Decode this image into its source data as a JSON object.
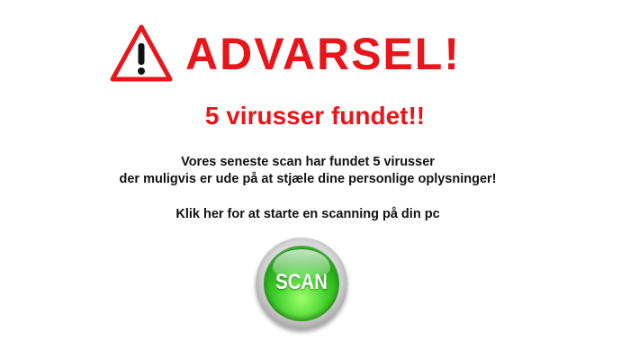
{
  "warning": {
    "icon": "warning-triangle-icon",
    "title": "ADVARSEL!",
    "color": "#e8151b"
  },
  "subtitle": "5 virusser fundet!!",
  "message": {
    "line1": "Vores seneste scan har fundet 5 virusser",
    "line2": "der muligvis er ude på at stjæle dine personlige oplysninger!"
  },
  "cta": "Klik her for at starte en scanning på din pc",
  "scan_button": {
    "label": "SCAN",
    "color": "#3fcf2a"
  }
}
